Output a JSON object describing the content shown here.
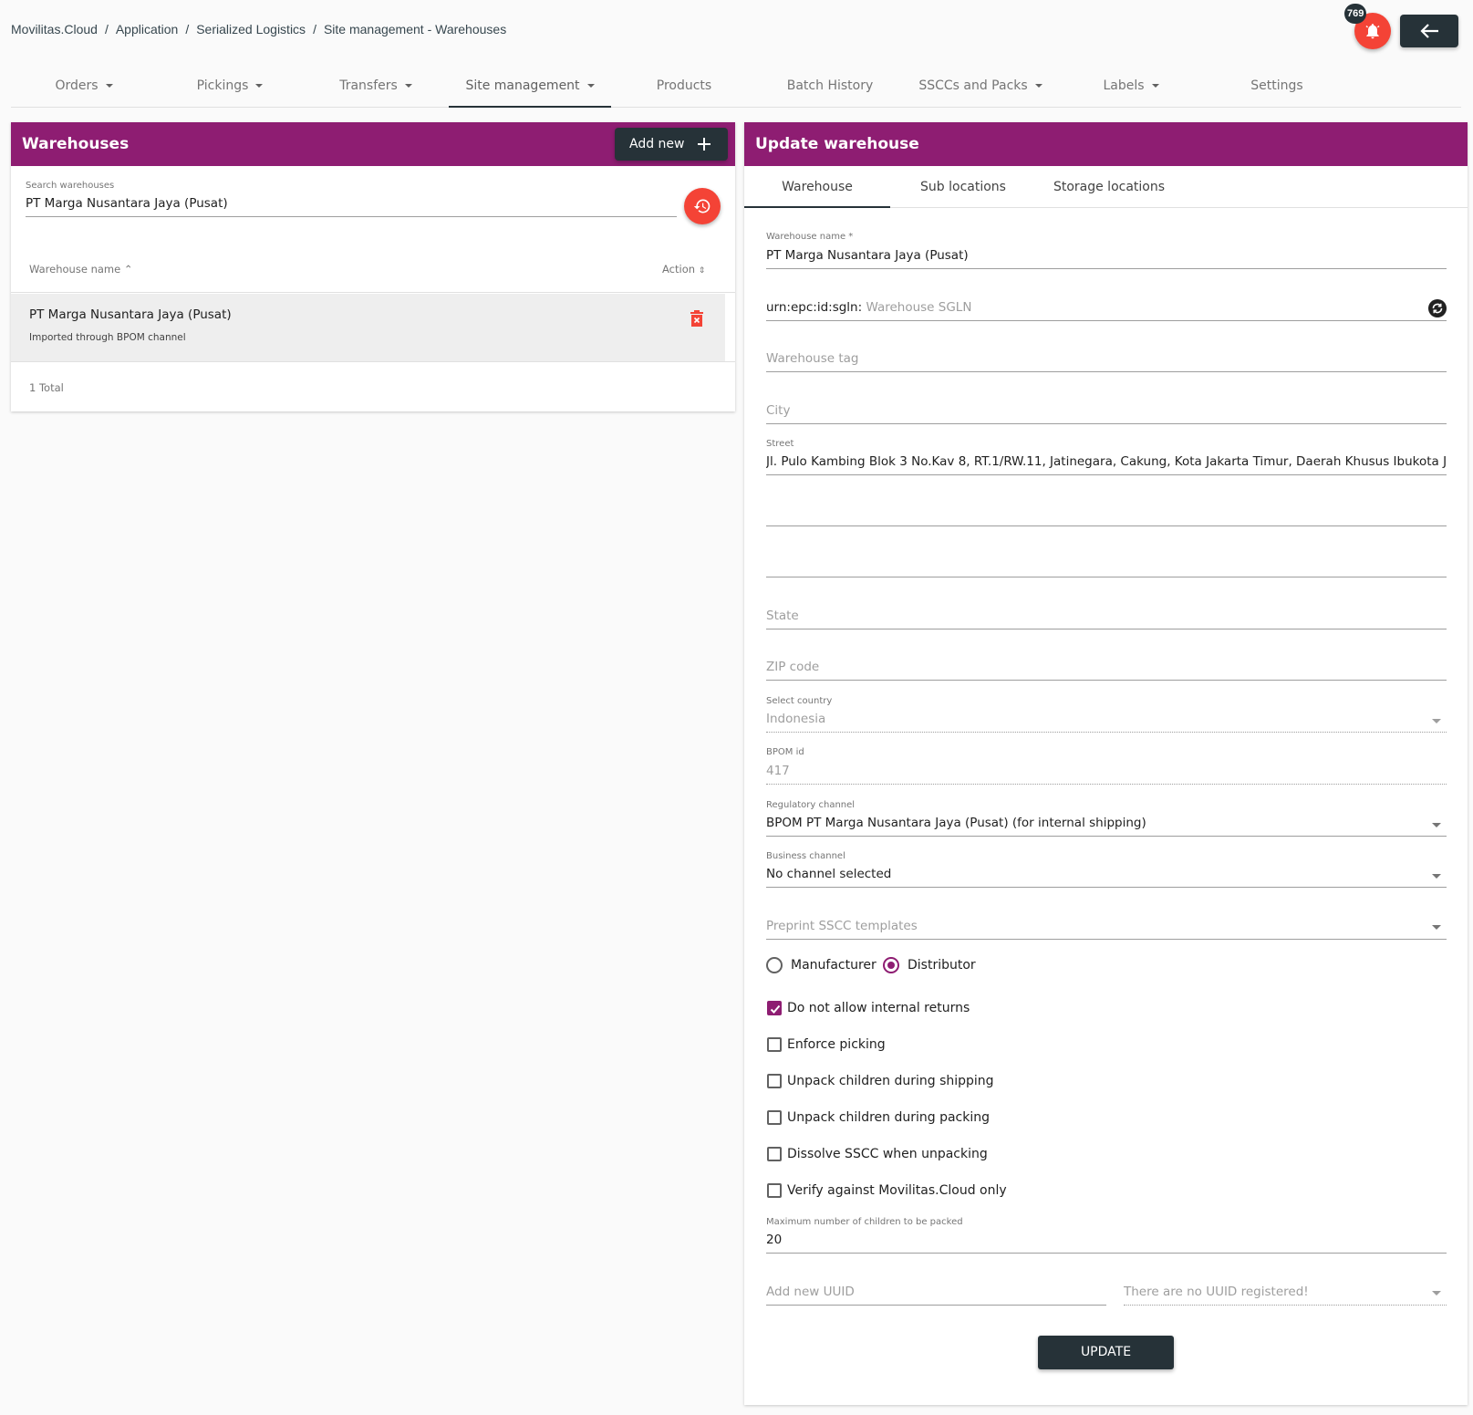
{
  "breadcrumb": [
    "Movilitas.Cloud",
    "Application",
    "Serialized Logistics",
    "Site management - Warehouses"
  ],
  "notifications": {
    "count": "769"
  },
  "nav": {
    "tabs": [
      {
        "label": "Orders"
      },
      {
        "label": "Pickings"
      },
      {
        "label": "Transfers"
      },
      {
        "label": "Site management"
      },
      {
        "label": "Products"
      },
      {
        "label": "Batch History"
      },
      {
        "label": "SSCCs and Packs"
      },
      {
        "label": "Labels"
      },
      {
        "label": "Settings"
      }
    ]
  },
  "warehouses": {
    "title": "Warehouses",
    "add_new": "Add new",
    "search_label": "Search warehouses",
    "search_value": "PT Marga Nusantara Jaya (Pusat)",
    "col_name": "Warehouse name",
    "col_action": "Action",
    "rows": [
      {
        "name": "PT Marga Nusantara Jaya (Pusat)",
        "sub": "Imported through BPOM channel"
      }
    ],
    "total": "1 Total"
  },
  "update": {
    "title": "Update warehouse",
    "tabs": [
      "Warehouse",
      "Sub locations",
      "Storage locations"
    ],
    "name_label": "Warehouse name *",
    "name_value": "PT Marga Nusantara Jaya (Pusat)",
    "sgln_prefix": "urn:epc:id:sgln:",
    "sgln_placeholder": "Warehouse SGLN",
    "tag_placeholder": "Warehouse tag",
    "city_placeholder": "City",
    "street_label": "Street",
    "street_value": "Jl. Pulo Kambing Blok 3 No.Kav 8, RT.1/RW.11, Jatinegara, Cakung, Kota Jakarta Timur, Daerah Khusus Ibukota Jakarta",
    "state_placeholder": "State",
    "zip_placeholder": "ZIP code",
    "country_label": "Select country",
    "country_value": "Indonesia",
    "bpom_label": "BPOM id",
    "bpom_value": "417",
    "reg_label": "Regulatory channel",
    "reg_value": "BPOM PT Marga Nusantara Jaya (Pusat) (for internal shipping)",
    "biz_label": "Business channel",
    "biz_value": "No channel selected",
    "preprint_placeholder": "Preprint SSCC templates",
    "radio_manufacturer": "Manufacturer",
    "radio_distributor": "Distributor",
    "checkboxes": [
      {
        "label": "Do not allow internal returns",
        "checked": true
      },
      {
        "label": "Enforce picking",
        "checked": false
      },
      {
        "label": "Unpack children during shipping",
        "checked": false
      },
      {
        "label": "Unpack children during packing",
        "checked": false
      },
      {
        "label": "Dissolve SSCC when unpacking",
        "checked": false
      },
      {
        "label": "Verify against Movilitas.Cloud only",
        "checked": false
      }
    ],
    "max_children_label": "Maximum number of children to be packed",
    "max_children_value": "20",
    "uuid_placeholder": "Add new UUID",
    "uuid_select_placeholder": "There are no UUID registered!",
    "update_button": "UPDATE"
  },
  "colors": {
    "brand": "#8e1d72",
    "dark": "#263238",
    "danger": "#f44336"
  }
}
